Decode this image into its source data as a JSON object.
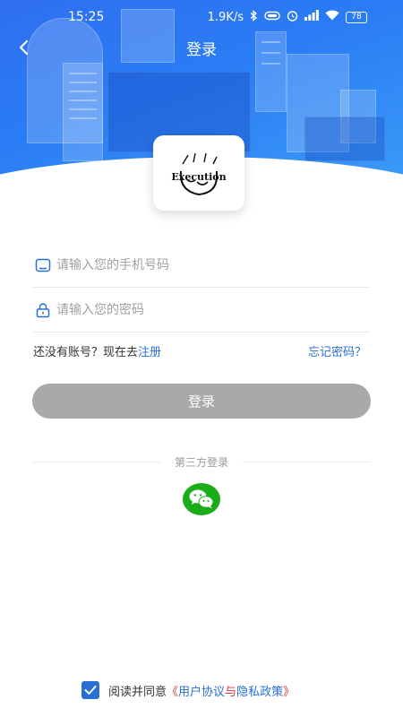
{
  "status_bar": {
    "time": "15:25",
    "network_speed": "1.9K/s",
    "battery": "78"
  },
  "nav": {
    "title": "登录"
  },
  "logo": {
    "text": "Execution"
  },
  "form": {
    "phone_placeholder": "请输入您的手机号码",
    "password_placeholder": "请输入您的密码",
    "no_account_text": "还没有账号？现在去",
    "register_link": "注册",
    "forgot_password": "忘记密码？",
    "login_button": "登录"
  },
  "third_party": {
    "label": "第三方登录",
    "wechat_icon": "wechat-icon"
  },
  "agreement": {
    "prefix": "阅读并同意",
    "open_quote": "《",
    "user_agreement": "用户协议",
    "and": "与",
    "privacy_policy": "隐私政策",
    "close_quote": "》",
    "checked": true
  },
  "colors": {
    "accent_blue": "#2a6fd6",
    "header_blue": "#2f6ff0",
    "button_gray": "#a9a9a9",
    "wechat_green": "#1aad19",
    "quote_red": "#e8333a"
  }
}
